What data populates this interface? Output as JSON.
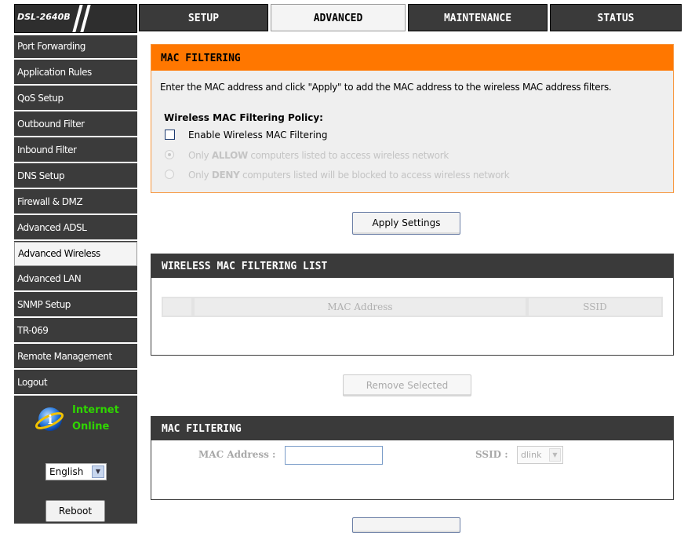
{
  "header": {
    "model": "DSL-2640B",
    "tabs": [
      {
        "label": "SETUP",
        "active": false
      },
      {
        "label": "ADVANCED",
        "active": true
      },
      {
        "label": "MAINTENANCE",
        "active": false
      },
      {
        "label": "STATUS",
        "active": false
      }
    ]
  },
  "sidebar": {
    "items": [
      {
        "label": "Port Forwarding"
      },
      {
        "label": "Application Rules"
      },
      {
        "label": "QoS Setup"
      },
      {
        "label": "Outbound Filter"
      },
      {
        "label": "Inbound Filter"
      },
      {
        "label": "DNS Setup"
      },
      {
        "label": "Firewall & DMZ"
      },
      {
        "label": "Advanced ADSL"
      },
      {
        "label": "Advanced Wireless",
        "active": true
      },
      {
        "label": "Advanced LAN"
      },
      {
        "label": "SNMP Setup"
      },
      {
        "label": "TR-069"
      },
      {
        "label": "Remote Management"
      },
      {
        "label": "Logout"
      }
    ],
    "status_line1": "Internet",
    "status_line2": "Online",
    "language": "English",
    "reboot_label": "Reboot"
  },
  "mac_filtering_panel": {
    "title": "MAC FILTERING",
    "description": "Enter the MAC address and click \"Apply\" to add the MAC address to the wireless MAC address filters.",
    "policy_title": "Wireless MAC Filtering Policy:",
    "enable_label": "Enable Wireless MAC Filtering",
    "enable_checked": false,
    "allow_prefix": "Only ",
    "allow_keyword": "ALLOW",
    "allow_suffix": " computers listed to access wireless network",
    "deny_prefix": "Only ",
    "deny_keyword": "DENY",
    "deny_suffix": " computers listed will be blocked to access wireless network"
  },
  "apply_settings_label": "Apply Settings",
  "filter_list": {
    "title": "WIRELESS MAC FILTERING LIST",
    "columns": [
      "",
      "MAC Address",
      "SSID"
    ]
  },
  "remove_selected_label": "Remove Selected",
  "mac_entry": {
    "title": "MAC FILTERING",
    "mac_label": "MAC Address :",
    "mac_value": "",
    "ssid_label": "SSID :",
    "ssid_value": "dlink"
  },
  "colors": {
    "accent_orange": "#ff7700",
    "dark_gray": "#3a3a3a",
    "status_green": "#2fd600"
  }
}
